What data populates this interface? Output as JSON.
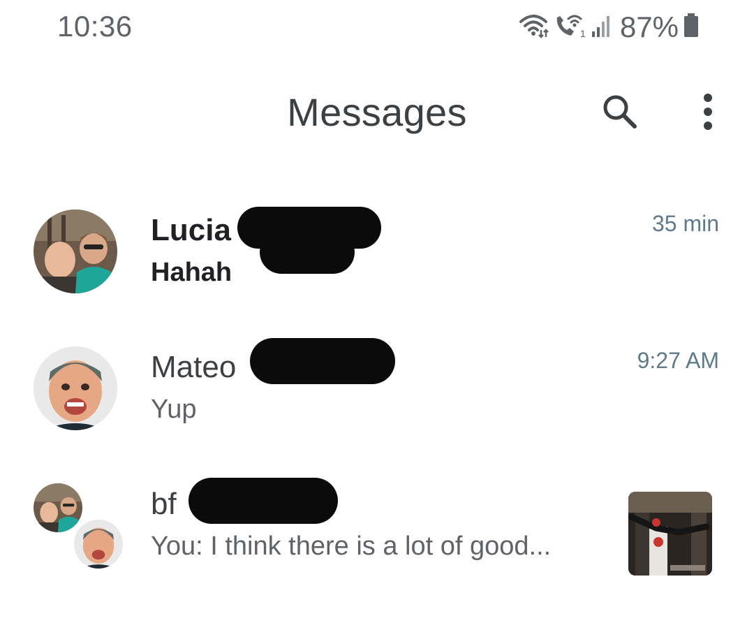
{
  "status_bar": {
    "time": "10:36",
    "battery_percent": "87%",
    "icons": [
      "wifi-icon",
      "wifi-calling-icon",
      "signal-icon",
      "battery-icon"
    ]
  },
  "app_bar": {
    "title": "Messages",
    "search_icon": "search-icon",
    "more_icon": "more-vert-icon"
  },
  "conversations": [
    {
      "name": "Lucia S",
      "snippet": "Hahah",
      "time": "35 min",
      "unread": true
    },
    {
      "name": "Mateo",
      "snippet": "Yup",
      "time": "9:27 AM",
      "unread": false
    },
    {
      "name": "bf",
      "snippet": "You: I think there is a lot of good...",
      "time": "",
      "unread": false,
      "has_thumbnail": true
    }
  ],
  "colors": {
    "time_text": "#5f7a89",
    "secondary_text": "#5f6368",
    "primary_text": "#202124"
  }
}
